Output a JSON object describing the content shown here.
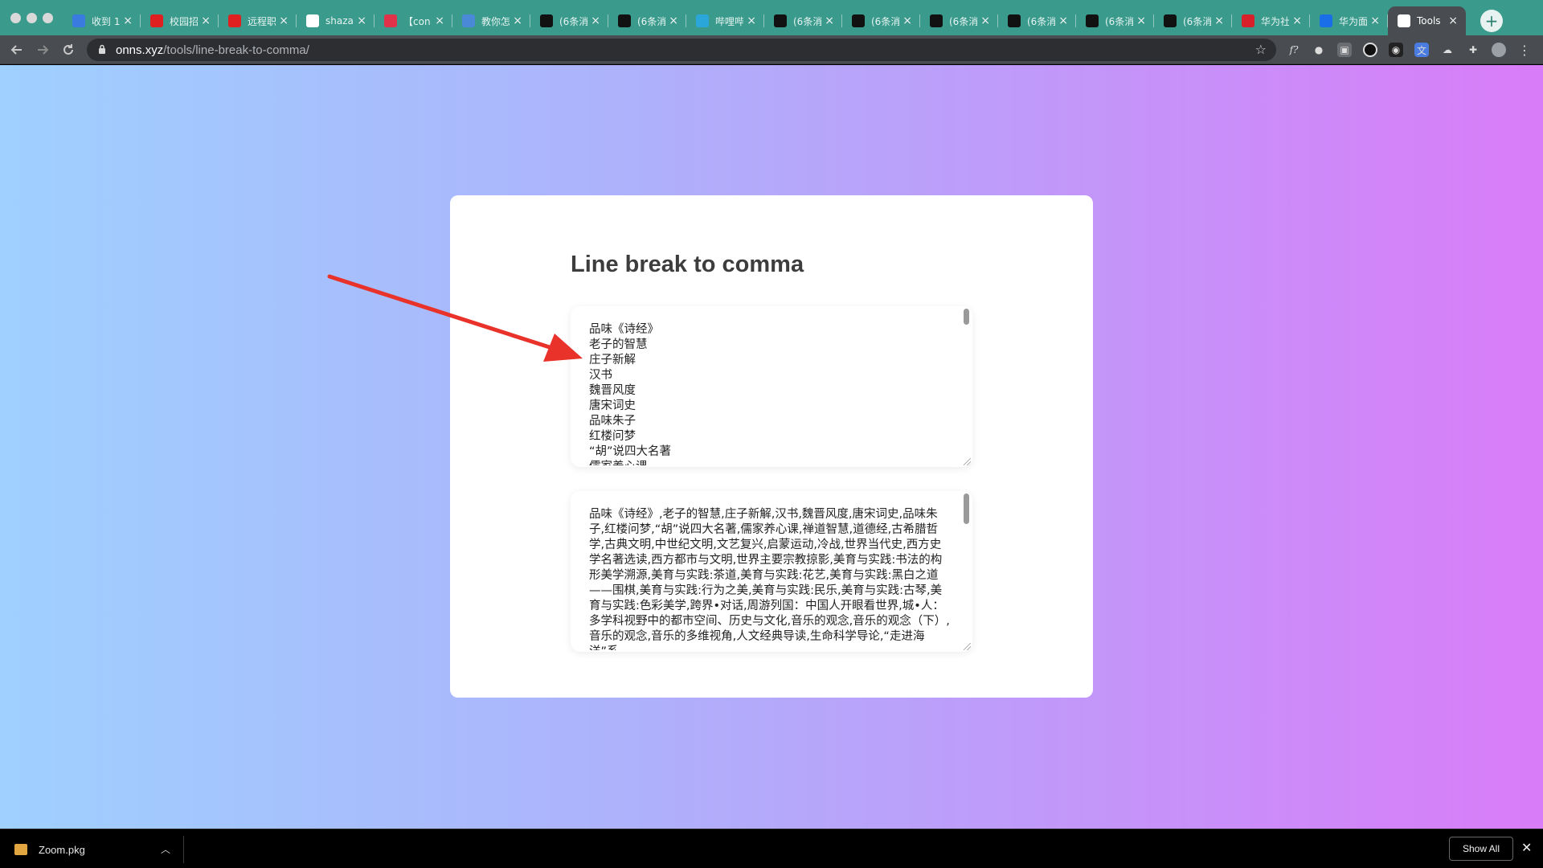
{
  "browser": {
    "tabs": [
      {
        "title": "收到 1",
        "icon": "feishu-icon",
        "color": "#3a7be0"
      },
      {
        "title": "校园招",
        "icon": "huawei-icon",
        "color": "#e02020"
      },
      {
        "title": "远程职",
        "icon": "huawei-icon",
        "color": "#e02020"
      },
      {
        "title": "shaza",
        "icon": "google-icon",
        "color": "#ffffff"
      },
      {
        "title": "【con",
        "icon": "y-icon",
        "color": "#e0334a"
      },
      {
        "title": "教你怎",
        "icon": "docs-icon",
        "color": "#4a88d8"
      },
      {
        "title": "(6条消",
        "icon": "csdn-icon",
        "color": "#111111"
      },
      {
        "title": "(6条消",
        "icon": "csdn-icon",
        "color": "#111111"
      },
      {
        "title": "哔哩哔",
        "icon": "bilibili-icon",
        "color": "#2aa6d8"
      },
      {
        "title": "(6条消",
        "icon": "csdn-icon",
        "color": "#111111"
      },
      {
        "title": "(6条消",
        "icon": "csdn-icon",
        "color": "#111111"
      },
      {
        "title": "(6条消",
        "icon": "csdn-icon",
        "color": "#111111"
      },
      {
        "title": "(6条消",
        "icon": "csdn-icon",
        "color": "#111111"
      },
      {
        "title": "(6条消",
        "icon": "csdn-icon",
        "color": "#111111"
      },
      {
        "title": "(6条消",
        "icon": "csdn-icon",
        "color": "#111111"
      },
      {
        "title": "华为社",
        "icon": "c-icon",
        "color": "#d8202a"
      },
      {
        "title": "华为面",
        "icon": "zhihu-icon",
        "color": "#1a6ee8"
      },
      {
        "title": "Tools",
        "icon": "page-icon",
        "color": "#ffffff",
        "active": true
      }
    ],
    "url_host": "onns.xyz",
    "url_path": "/tools/line-break-to-comma/"
  },
  "page": {
    "title": "Line break to comma",
    "input_text": "品味《诗经》\n老子的智慧\n庄子新解\n汉书\n魏晋风度\n唐宋词史\n品味朱子\n红楼问梦\n“胡”说四大名著\n儒家养心课",
    "output_text": "品味《诗经》,老子的智慧,庄子新解,汉书,魏晋风度,唐宋词史,品味朱子,红楼问梦,“胡”说四大名著,儒家养心课,禅道智慧,道德经,古希腊哲学,古典文明,中世纪文明,文艺复兴,启蒙运动,冷战,世界当代史,西方史学名著选读,西方都市与文明,世界主要宗教掠影,美育与实践:书法的构形美学溯源,美育与实践:茶道,美育与实践:花艺,美育与实践:黑白之道——围棋,美育与实践:行为之美,美育与实践:民乐,美育与实践:古琴,美育与实践:色彩美学,跨界•对话,周游列国：中国人开眼看世界,城•人：多学科视野中的都市空间、历史与文化,音乐的观念,音乐的观念（下）,音乐的观念,音乐的多维视角,人文经典导读,生命科学导论,“走进海洋”系"
  },
  "downloads": {
    "filename": "Zoom.pkg",
    "show_all": "Show All"
  },
  "colors": {
    "tabstrip": "#3a9a8c",
    "toolbar": "#494c50",
    "gradient_start": "#9fd0ff",
    "gradient_end": "#d97cf8",
    "arrow": "#e8322a"
  }
}
